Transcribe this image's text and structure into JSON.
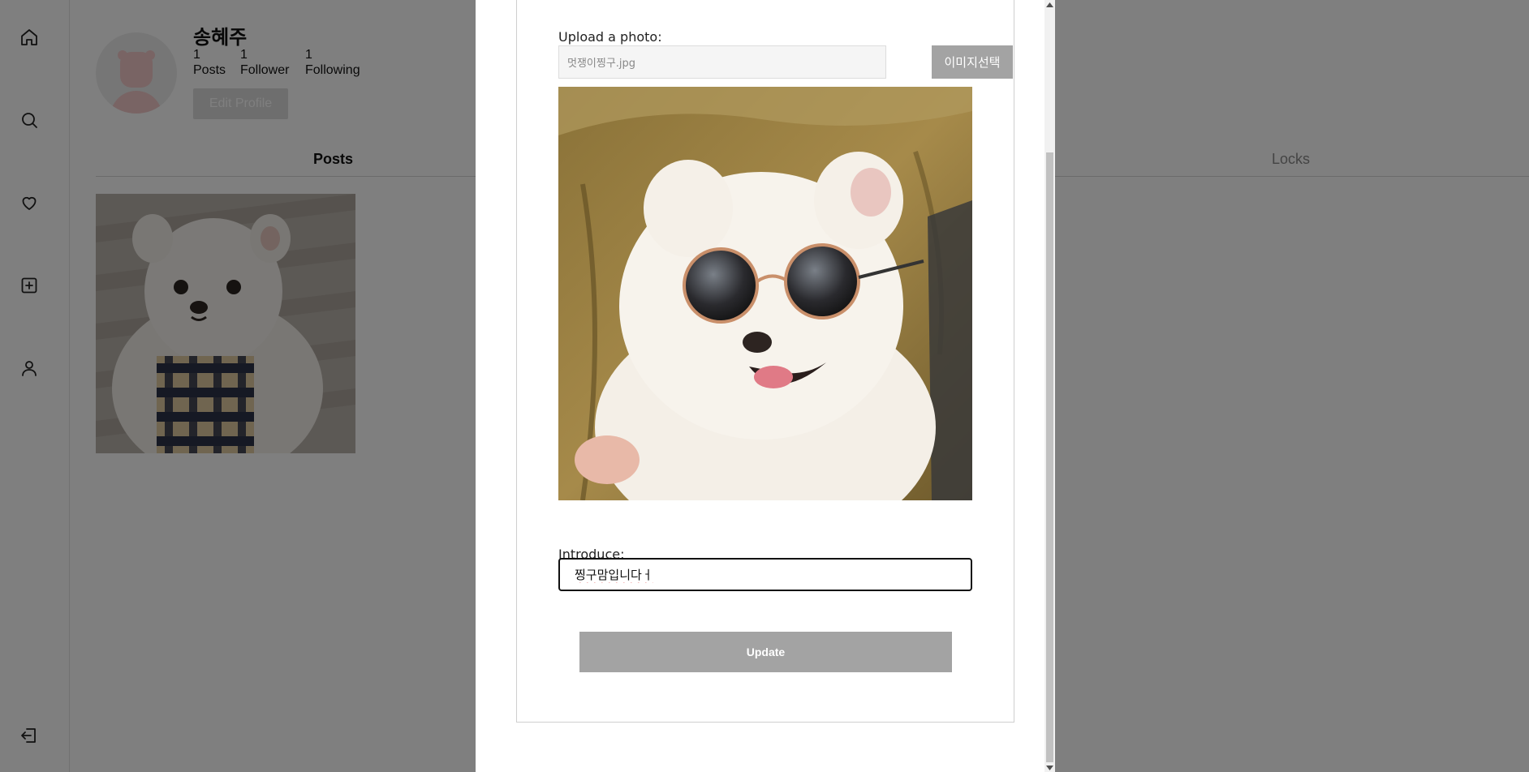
{
  "sidebar": {
    "icons": [
      "home-icon",
      "search-icon",
      "heart-icon",
      "add-square-icon",
      "user-icon"
    ],
    "logout_icon": "logout-icon"
  },
  "profile": {
    "username": "송혜주",
    "stats": [
      {
        "num": "1",
        "label": "Posts"
      },
      {
        "num": "1",
        "label": "Follower"
      },
      {
        "num": "1",
        "label": "Following"
      }
    ],
    "edit_label": "Edit Profile"
  },
  "tabs": {
    "posts": "Posts",
    "locks": "Locks"
  },
  "modal": {
    "upload_label": "Upload a photo:",
    "file_name": "멋쟁이찡구.jpg",
    "choose_button": "이미지선택",
    "introduce_label": "Introduce:",
    "introduce_value": "찡구맘입니다ㅓ",
    "update_button": "Update"
  },
  "colors": {
    "overlay": "rgba(0,0,0,0.5)",
    "button_gray": "#a3a3a3"
  }
}
